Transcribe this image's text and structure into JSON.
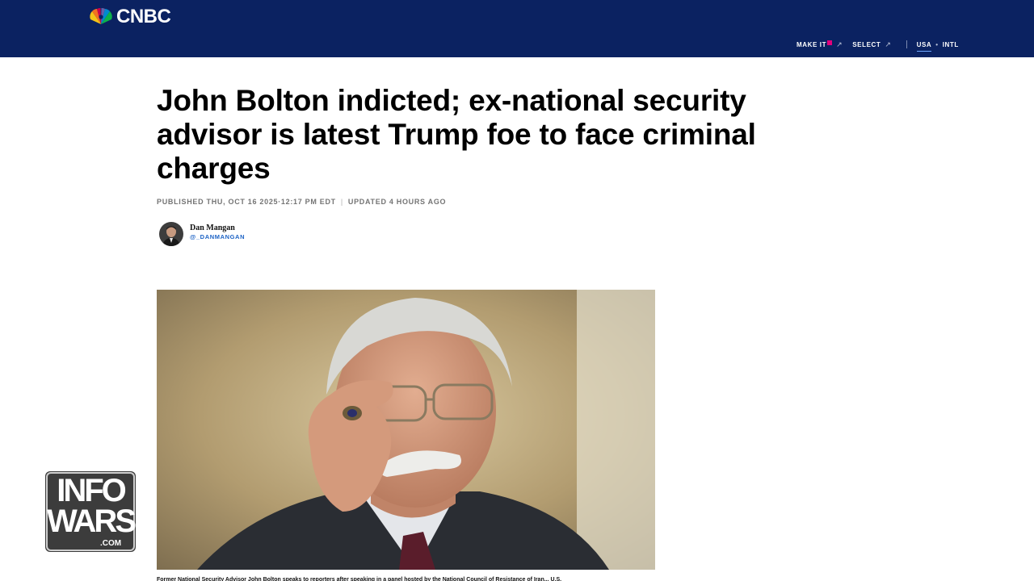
{
  "header": {
    "logo_text": "CNBC",
    "nav": {
      "make_it": "MAKE IT",
      "select": "SELECT",
      "editions": [
        "USA",
        "INTL"
      ],
      "active_edition": "USA"
    },
    "colors": {
      "bar": "#0b2261",
      "text": "#ffffff"
    }
  },
  "article": {
    "headline": "John Bolton indicted; ex-national security advisor is latest Trump foe to face criminal charges",
    "published": "PUBLISHED THU, OCT 16 2025·12:17 PM EDT",
    "updated": "UPDATED 4 HOURS AGO",
    "author": {
      "name": "Dan Mangan",
      "handle": "@_DANMANGAN"
    },
    "image": {
      "icon": "photo-of-john-bolton"
    },
    "caption": "Former National Security Advisor John Bolton speaks to reporters after speaking in a panel hosted by the National Council of Resistance of Iran... U.S."
  },
  "watermark": {
    "line1": "INFO",
    "line2": "WARS",
    "line3": ".COM"
  }
}
